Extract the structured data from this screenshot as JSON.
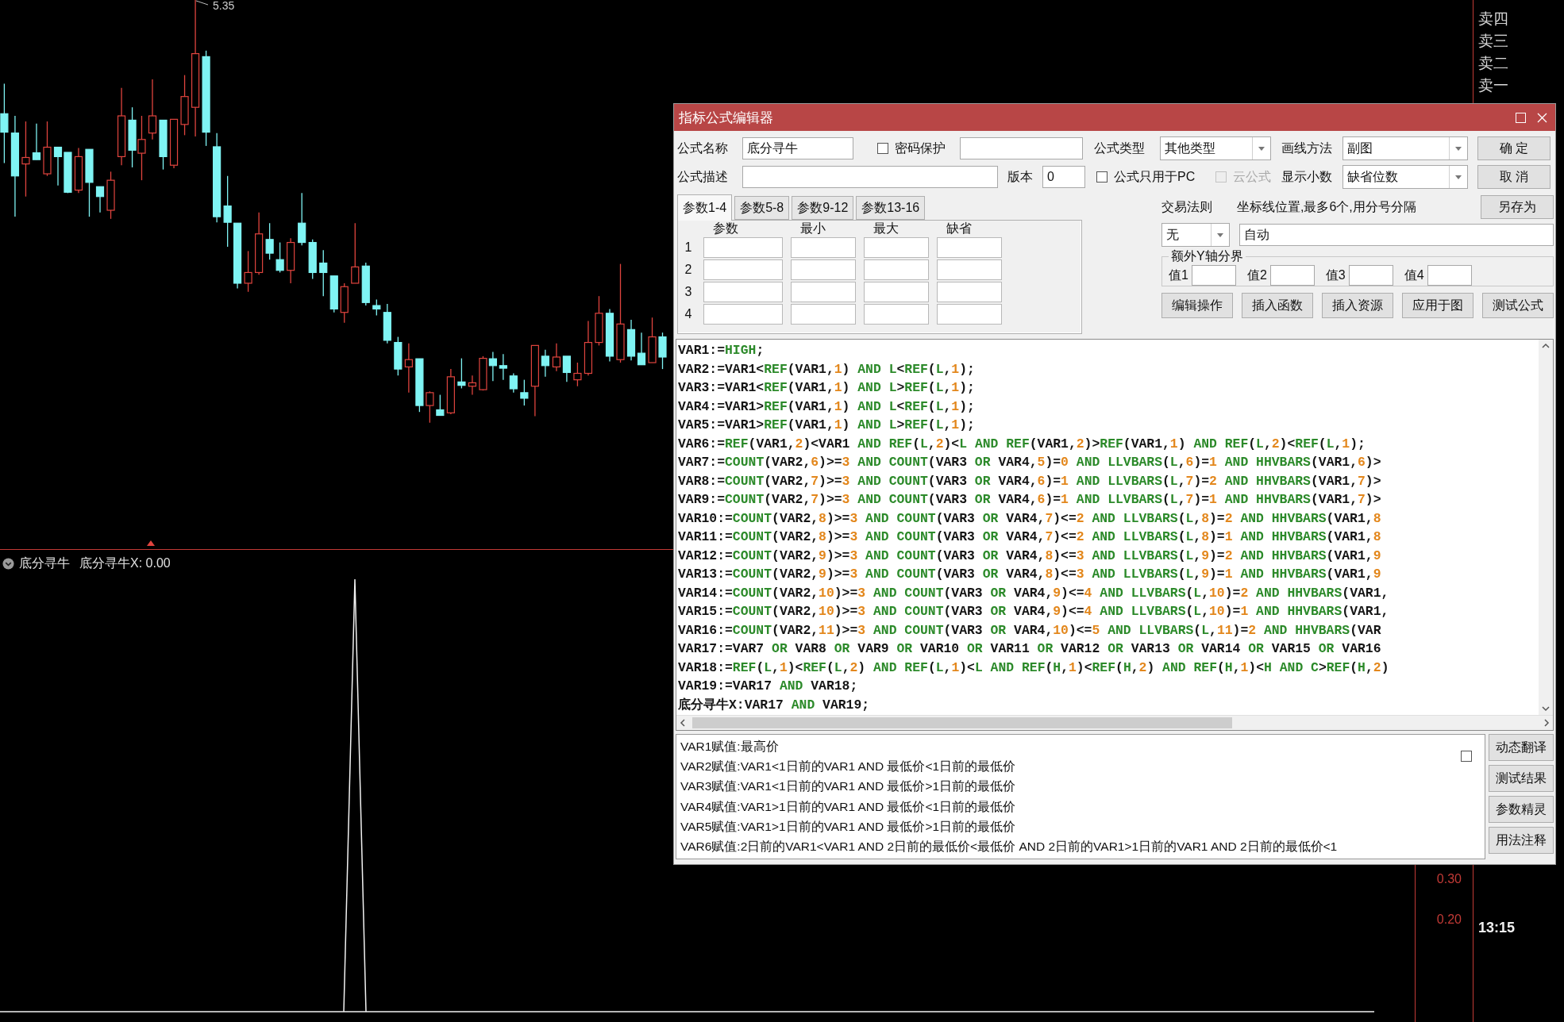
{
  "chart": {
    "high_label": "5.35"
  },
  "order_book": {
    "labels": [
      "卖四",
      "卖三",
      "卖二",
      "卖一"
    ]
  },
  "indicator_panel": {
    "name": "底分寻牛",
    "value_label": "底分寻牛X: 0.00",
    "axis_labels": [
      "0.30",
      "0.20"
    ],
    "time": "13:15"
  },
  "dialog": {
    "title": "指标公式编辑器",
    "name_label": "公式名称",
    "name_value": "底分寻牛",
    "password": {
      "label": "密码保护",
      "checked": false
    },
    "type_label": "公式类型",
    "type_value": "其他类型",
    "draw_label": "画线方法",
    "draw_value": "副图",
    "desc_label": "公式描述",
    "version_label": "版本",
    "version_value": "0",
    "pc_only": {
      "label": "公式只用于PC",
      "checked": false
    },
    "cloud": {
      "label": "云公式",
      "checked": false,
      "disabled": true
    },
    "decimals_label": "显示小数",
    "decimals_value": "缺省位数",
    "side_buttons": [
      "确 定",
      "取 消"
    ],
    "save_as_button": "另存为",
    "param_tabs": [
      {
        "label": "参数1-4",
        "selected": true
      },
      {
        "label": "参数5-8",
        "selected": false
      },
      {
        "label": "参数9-12",
        "selected": false
      },
      {
        "label": "参数13-16",
        "selected": false
      }
    ],
    "param_columns": [
      "参数",
      "最小",
      "最大",
      "缺省"
    ],
    "param_rows": [
      "1",
      "2",
      "3",
      "4"
    ],
    "trade_rule_label": "交易法则",
    "trade_rule_value": "无",
    "axis_label": "坐标线位置,最多6个,用分号分隔",
    "axis_value": "自动",
    "y_group": {
      "title": "额外Y轴分界",
      "values": [
        "值1",
        "值2",
        "值3",
        "值4"
      ]
    },
    "action_buttons": [
      "编辑操作",
      "插入函数",
      "插入资源",
      "应用于图",
      "测试公式"
    ],
    "code_lines": [
      {
        "tokens": [
          {
            "text": "VAR1:=",
            "kind": "plain"
          },
          {
            "text": "HIGH",
            "kind": "func"
          },
          {
            "text": ";",
            "kind": "plain"
          }
        ]
      },
      {
        "tokens": [
          {
            "text": "VAR2:=VAR1<",
            "kind": "plain"
          },
          {
            "text": "REF",
            "kind": "func"
          },
          {
            "text": "(VAR1,",
            "kind": "plain"
          },
          {
            "text": "1",
            "kind": "num"
          },
          {
            "text": ") ",
            "kind": "plain"
          },
          {
            "text": "AND L",
            "kind": "func"
          },
          {
            "text": "<",
            "kind": "plain"
          },
          {
            "text": "REF",
            "kind": "func"
          },
          {
            "text": "(",
            "kind": "plain"
          },
          {
            "text": "L",
            "kind": "func"
          },
          {
            "text": ",",
            "kind": "plain"
          },
          {
            "text": "1",
            "kind": "num"
          },
          {
            "text": ");",
            "kind": "plain"
          }
        ]
      },
      {
        "tokens": [
          {
            "text": "VAR3:=VAR1<",
            "kind": "plain"
          },
          {
            "text": "REF",
            "kind": "func"
          },
          {
            "text": "(VAR1,",
            "kind": "plain"
          },
          {
            "text": "1",
            "kind": "num"
          },
          {
            "text": ") ",
            "kind": "plain"
          },
          {
            "text": "AND L",
            "kind": "func"
          },
          {
            "text": ">",
            "kind": "plain"
          },
          {
            "text": "REF",
            "kind": "func"
          },
          {
            "text": "(",
            "kind": "plain"
          },
          {
            "text": "L",
            "kind": "func"
          },
          {
            "text": ",",
            "kind": "plain"
          },
          {
            "text": "1",
            "kind": "num"
          },
          {
            "text": ");",
            "kind": "plain"
          }
        ]
      },
      {
        "tokens": [
          {
            "text": "VAR4:=VAR1>",
            "kind": "plain"
          },
          {
            "text": "REF",
            "kind": "func"
          },
          {
            "text": "(VAR1,",
            "kind": "plain"
          },
          {
            "text": "1",
            "kind": "num"
          },
          {
            "text": ") ",
            "kind": "plain"
          },
          {
            "text": "AND L",
            "kind": "func"
          },
          {
            "text": "<",
            "kind": "plain"
          },
          {
            "text": "REF",
            "kind": "func"
          },
          {
            "text": "(",
            "kind": "plain"
          },
          {
            "text": "L",
            "kind": "func"
          },
          {
            "text": ",",
            "kind": "plain"
          },
          {
            "text": "1",
            "kind": "num"
          },
          {
            "text": ");",
            "kind": "plain"
          }
        ]
      },
      {
        "tokens": [
          {
            "text": "VAR5:=VAR1>",
            "kind": "plain"
          },
          {
            "text": "REF",
            "kind": "func"
          },
          {
            "text": "(VAR1,",
            "kind": "plain"
          },
          {
            "text": "1",
            "kind": "num"
          },
          {
            "text": ") ",
            "kind": "plain"
          },
          {
            "text": "AND L",
            "kind": "func"
          },
          {
            "text": ">",
            "kind": "plain"
          },
          {
            "text": "REF",
            "kind": "func"
          },
          {
            "text": "(",
            "kind": "plain"
          },
          {
            "text": "L",
            "kind": "func"
          },
          {
            "text": ",",
            "kind": "plain"
          },
          {
            "text": "1",
            "kind": "num"
          },
          {
            "text": ");",
            "kind": "plain"
          }
        ]
      },
      {
        "tokens": [
          {
            "text": "VAR6:=",
            "kind": "plain"
          },
          {
            "text": "REF",
            "kind": "func"
          },
          {
            "text": "(VAR1,",
            "kind": "plain"
          },
          {
            "text": "2",
            "kind": "num"
          },
          {
            "text": ")<VAR1 ",
            "kind": "plain"
          },
          {
            "text": "AND REF",
            "kind": "func"
          },
          {
            "text": "(",
            "kind": "plain"
          },
          {
            "text": "L",
            "kind": "func"
          },
          {
            "text": ",",
            "kind": "plain"
          },
          {
            "text": "2",
            "kind": "num"
          },
          {
            "text": ")<",
            "kind": "plain"
          },
          {
            "text": "L AND REF",
            "kind": "func"
          },
          {
            "text": "(VAR1,",
            "kind": "plain"
          },
          {
            "text": "2",
            "kind": "num"
          },
          {
            "text": ")>",
            "kind": "plain"
          },
          {
            "text": "REF",
            "kind": "func"
          },
          {
            "text": "(VAR1,",
            "kind": "plain"
          },
          {
            "text": "1",
            "kind": "num"
          },
          {
            "text": ") ",
            "kind": "plain"
          },
          {
            "text": "AND REF",
            "kind": "func"
          },
          {
            "text": "(",
            "kind": "plain"
          },
          {
            "text": "L",
            "kind": "func"
          },
          {
            "text": ",",
            "kind": "plain"
          },
          {
            "text": "2",
            "kind": "num"
          },
          {
            "text": ")<",
            "kind": "plain"
          },
          {
            "text": "REF",
            "kind": "func"
          },
          {
            "text": "(",
            "kind": "plain"
          },
          {
            "text": "L",
            "kind": "func"
          },
          {
            "text": ",",
            "kind": "plain"
          },
          {
            "text": "1",
            "kind": "num"
          },
          {
            "text": ");",
            "kind": "plain"
          }
        ]
      },
      {
        "tokens": [
          {
            "text": "VAR7:=",
            "kind": "plain"
          },
          {
            "text": "COUNT",
            "kind": "func"
          },
          {
            "text": "(VAR2,",
            "kind": "plain"
          },
          {
            "text": "6",
            "kind": "num"
          },
          {
            "text": ")>=",
            "kind": "plain"
          },
          {
            "text": "3",
            "kind": "num"
          },
          {
            "text": " AND COUNT",
            "kind": "func"
          },
          {
            "text": "(VAR3 ",
            "kind": "plain"
          },
          {
            "text": "OR",
            "kind": "func"
          },
          {
            "text": " VAR4,",
            "kind": "plain"
          },
          {
            "text": "5",
            "kind": "num"
          },
          {
            "text": ")=",
            "kind": "plain"
          },
          {
            "text": "0",
            "kind": "num"
          },
          {
            "text": " AND LLVBARS",
            "kind": "func"
          },
          {
            "text": "(",
            "kind": "plain"
          },
          {
            "text": "L",
            "kind": "func"
          },
          {
            "text": ",",
            "kind": "plain"
          },
          {
            "text": "6",
            "kind": "num"
          },
          {
            "text": ")=",
            "kind": "plain"
          },
          {
            "text": "1",
            "kind": "num"
          },
          {
            "text": " AND HHVBARS",
            "kind": "func"
          },
          {
            "text": "(VAR1,",
            "kind": "plain"
          },
          {
            "text": "6",
            "kind": "num"
          },
          {
            "text": ")>",
            "kind": "plain"
          }
        ]
      },
      {
        "tokens": [
          {
            "text": "VAR8:=",
            "kind": "plain"
          },
          {
            "text": "COUNT",
            "kind": "func"
          },
          {
            "text": "(VAR2,",
            "kind": "plain"
          },
          {
            "text": "7",
            "kind": "num"
          },
          {
            "text": ")>=",
            "kind": "plain"
          },
          {
            "text": "3",
            "kind": "num"
          },
          {
            "text": " AND COUNT",
            "kind": "func"
          },
          {
            "text": "(VAR3 ",
            "kind": "plain"
          },
          {
            "text": "OR",
            "kind": "func"
          },
          {
            "text": " VAR4,",
            "kind": "plain"
          },
          {
            "text": "6",
            "kind": "num"
          },
          {
            "text": ")=",
            "kind": "plain"
          },
          {
            "text": "1",
            "kind": "num"
          },
          {
            "text": " AND LLVBARS",
            "kind": "func"
          },
          {
            "text": "(",
            "kind": "plain"
          },
          {
            "text": "L",
            "kind": "func"
          },
          {
            "text": ",",
            "kind": "plain"
          },
          {
            "text": "7",
            "kind": "num"
          },
          {
            "text": ")=",
            "kind": "plain"
          },
          {
            "text": "2",
            "kind": "num"
          },
          {
            "text": " AND HHVBARS",
            "kind": "func"
          },
          {
            "text": "(VAR1,",
            "kind": "plain"
          },
          {
            "text": "7",
            "kind": "num"
          },
          {
            "text": ")>",
            "kind": "plain"
          }
        ]
      },
      {
        "tokens": [
          {
            "text": "VAR9:=",
            "kind": "plain"
          },
          {
            "text": "COUNT",
            "kind": "func"
          },
          {
            "text": "(VAR2,",
            "kind": "plain"
          },
          {
            "text": "7",
            "kind": "num"
          },
          {
            "text": ")>=",
            "kind": "plain"
          },
          {
            "text": "3",
            "kind": "num"
          },
          {
            "text": " AND COUNT",
            "kind": "func"
          },
          {
            "text": "(VAR3 ",
            "kind": "plain"
          },
          {
            "text": "OR",
            "kind": "func"
          },
          {
            "text": " VAR4,",
            "kind": "plain"
          },
          {
            "text": "6",
            "kind": "num"
          },
          {
            "text": ")=",
            "kind": "plain"
          },
          {
            "text": "1",
            "kind": "num"
          },
          {
            "text": " AND LLVBARS",
            "kind": "func"
          },
          {
            "text": "(",
            "kind": "plain"
          },
          {
            "text": "L",
            "kind": "func"
          },
          {
            "text": ",",
            "kind": "plain"
          },
          {
            "text": "7",
            "kind": "num"
          },
          {
            "text": ")=",
            "kind": "plain"
          },
          {
            "text": "1",
            "kind": "num"
          },
          {
            "text": " AND HHVBARS",
            "kind": "func"
          },
          {
            "text": "(VAR1,",
            "kind": "plain"
          },
          {
            "text": "7",
            "kind": "num"
          },
          {
            "text": ")>",
            "kind": "plain"
          }
        ]
      },
      {
        "tokens": [
          {
            "text": "VAR10:=",
            "kind": "plain"
          },
          {
            "text": "COUNT",
            "kind": "func"
          },
          {
            "text": "(VAR2,",
            "kind": "plain"
          },
          {
            "text": "8",
            "kind": "num"
          },
          {
            "text": ")>=",
            "kind": "plain"
          },
          {
            "text": "3",
            "kind": "num"
          },
          {
            "text": " AND COUNT",
            "kind": "func"
          },
          {
            "text": "(VAR3 ",
            "kind": "plain"
          },
          {
            "text": "OR",
            "kind": "func"
          },
          {
            "text": " VAR4,",
            "kind": "plain"
          },
          {
            "text": "7",
            "kind": "num"
          },
          {
            "text": ")<=",
            "kind": "plain"
          },
          {
            "text": "2",
            "kind": "num"
          },
          {
            "text": " AND LLVBARS",
            "kind": "func"
          },
          {
            "text": "(",
            "kind": "plain"
          },
          {
            "text": "L",
            "kind": "func"
          },
          {
            "text": ",",
            "kind": "plain"
          },
          {
            "text": "8",
            "kind": "num"
          },
          {
            "text": ")=",
            "kind": "plain"
          },
          {
            "text": "2",
            "kind": "num"
          },
          {
            "text": " AND HHVBARS",
            "kind": "func"
          },
          {
            "text": "(VAR1,",
            "kind": "plain"
          },
          {
            "text": "8",
            "kind": "num"
          }
        ]
      },
      {
        "tokens": [
          {
            "text": "VAR11:=",
            "kind": "plain"
          },
          {
            "text": "COUNT",
            "kind": "func"
          },
          {
            "text": "(VAR2,",
            "kind": "plain"
          },
          {
            "text": "8",
            "kind": "num"
          },
          {
            "text": ")>=",
            "kind": "plain"
          },
          {
            "text": "3",
            "kind": "num"
          },
          {
            "text": " AND COUNT",
            "kind": "func"
          },
          {
            "text": "(VAR3 ",
            "kind": "plain"
          },
          {
            "text": "OR",
            "kind": "func"
          },
          {
            "text": " VAR4,",
            "kind": "plain"
          },
          {
            "text": "7",
            "kind": "num"
          },
          {
            "text": ")<=",
            "kind": "plain"
          },
          {
            "text": "2",
            "kind": "num"
          },
          {
            "text": " AND LLVBARS",
            "kind": "func"
          },
          {
            "text": "(",
            "kind": "plain"
          },
          {
            "text": "L",
            "kind": "func"
          },
          {
            "text": ",",
            "kind": "plain"
          },
          {
            "text": "8",
            "kind": "num"
          },
          {
            "text": ")=",
            "kind": "plain"
          },
          {
            "text": "1",
            "kind": "num"
          },
          {
            "text": " AND HHVBARS",
            "kind": "func"
          },
          {
            "text": "(VAR1,",
            "kind": "plain"
          },
          {
            "text": "8",
            "kind": "num"
          }
        ]
      },
      {
        "tokens": [
          {
            "text": "VAR12:=",
            "kind": "plain"
          },
          {
            "text": "COUNT",
            "kind": "func"
          },
          {
            "text": "(VAR2,",
            "kind": "plain"
          },
          {
            "text": "9",
            "kind": "num"
          },
          {
            "text": ")>=",
            "kind": "plain"
          },
          {
            "text": "3",
            "kind": "num"
          },
          {
            "text": " AND COUNT",
            "kind": "func"
          },
          {
            "text": "(VAR3 ",
            "kind": "plain"
          },
          {
            "text": "OR",
            "kind": "func"
          },
          {
            "text": " VAR4,",
            "kind": "plain"
          },
          {
            "text": "8",
            "kind": "num"
          },
          {
            "text": ")<=",
            "kind": "plain"
          },
          {
            "text": "3",
            "kind": "num"
          },
          {
            "text": " AND LLVBARS",
            "kind": "func"
          },
          {
            "text": "(",
            "kind": "plain"
          },
          {
            "text": "L",
            "kind": "func"
          },
          {
            "text": ",",
            "kind": "plain"
          },
          {
            "text": "9",
            "kind": "num"
          },
          {
            "text": ")=",
            "kind": "plain"
          },
          {
            "text": "2",
            "kind": "num"
          },
          {
            "text": " AND HHVBARS",
            "kind": "func"
          },
          {
            "text": "(VAR1,",
            "kind": "plain"
          },
          {
            "text": "9",
            "kind": "num"
          }
        ]
      },
      {
        "tokens": [
          {
            "text": "VAR13:=",
            "kind": "plain"
          },
          {
            "text": "COUNT",
            "kind": "func"
          },
          {
            "text": "(VAR2,",
            "kind": "plain"
          },
          {
            "text": "9",
            "kind": "num"
          },
          {
            "text": ")>=",
            "kind": "plain"
          },
          {
            "text": "3",
            "kind": "num"
          },
          {
            "text": " AND COUNT",
            "kind": "func"
          },
          {
            "text": "(VAR3 ",
            "kind": "plain"
          },
          {
            "text": "OR",
            "kind": "func"
          },
          {
            "text": " VAR4,",
            "kind": "plain"
          },
          {
            "text": "8",
            "kind": "num"
          },
          {
            "text": ")<=",
            "kind": "plain"
          },
          {
            "text": "3",
            "kind": "num"
          },
          {
            "text": " AND LLVBARS",
            "kind": "func"
          },
          {
            "text": "(",
            "kind": "plain"
          },
          {
            "text": "L",
            "kind": "func"
          },
          {
            "text": ",",
            "kind": "plain"
          },
          {
            "text": "9",
            "kind": "num"
          },
          {
            "text": ")=",
            "kind": "plain"
          },
          {
            "text": "1",
            "kind": "num"
          },
          {
            "text": " AND HHVBARS",
            "kind": "func"
          },
          {
            "text": "(VAR1,",
            "kind": "plain"
          },
          {
            "text": "9",
            "kind": "num"
          }
        ]
      },
      {
        "tokens": [
          {
            "text": "VAR14:=",
            "kind": "plain"
          },
          {
            "text": "COUNT",
            "kind": "func"
          },
          {
            "text": "(VAR2,",
            "kind": "plain"
          },
          {
            "text": "10",
            "kind": "num"
          },
          {
            "text": ")>=",
            "kind": "plain"
          },
          {
            "text": "3",
            "kind": "num"
          },
          {
            "text": " AND COUNT",
            "kind": "func"
          },
          {
            "text": "(VAR3 ",
            "kind": "plain"
          },
          {
            "text": "OR",
            "kind": "func"
          },
          {
            "text": " VAR4,",
            "kind": "plain"
          },
          {
            "text": "9",
            "kind": "num"
          },
          {
            "text": ")<=",
            "kind": "plain"
          },
          {
            "text": "4",
            "kind": "num"
          },
          {
            "text": " AND LLVBARS",
            "kind": "func"
          },
          {
            "text": "(",
            "kind": "plain"
          },
          {
            "text": "L",
            "kind": "func"
          },
          {
            "text": ",",
            "kind": "plain"
          },
          {
            "text": "10",
            "kind": "num"
          },
          {
            "text": ")=",
            "kind": "plain"
          },
          {
            "text": "2",
            "kind": "num"
          },
          {
            "text": " AND HHVBARS",
            "kind": "func"
          },
          {
            "text": "(VAR1,",
            "kind": "plain"
          }
        ]
      },
      {
        "tokens": [
          {
            "text": "VAR15:=",
            "kind": "plain"
          },
          {
            "text": "COUNT",
            "kind": "func"
          },
          {
            "text": "(VAR2,",
            "kind": "plain"
          },
          {
            "text": "10",
            "kind": "num"
          },
          {
            "text": ")>=",
            "kind": "plain"
          },
          {
            "text": "3",
            "kind": "num"
          },
          {
            "text": " AND COUNT",
            "kind": "func"
          },
          {
            "text": "(VAR3 ",
            "kind": "plain"
          },
          {
            "text": "OR",
            "kind": "func"
          },
          {
            "text": " VAR4,",
            "kind": "plain"
          },
          {
            "text": "9",
            "kind": "num"
          },
          {
            "text": ")<=",
            "kind": "plain"
          },
          {
            "text": "4",
            "kind": "num"
          },
          {
            "text": " AND LLVBARS",
            "kind": "func"
          },
          {
            "text": "(",
            "kind": "plain"
          },
          {
            "text": "L",
            "kind": "func"
          },
          {
            "text": ",",
            "kind": "plain"
          },
          {
            "text": "10",
            "kind": "num"
          },
          {
            "text": ")=",
            "kind": "plain"
          },
          {
            "text": "1",
            "kind": "num"
          },
          {
            "text": " AND HHVBARS",
            "kind": "func"
          },
          {
            "text": "(VAR1,",
            "kind": "plain"
          }
        ]
      },
      {
        "tokens": [
          {
            "text": "VAR16:=",
            "kind": "plain"
          },
          {
            "text": "COUNT",
            "kind": "func"
          },
          {
            "text": "(VAR2,",
            "kind": "plain"
          },
          {
            "text": "11",
            "kind": "num"
          },
          {
            "text": ")>=",
            "kind": "plain"
          },
          {
            "text": "3",
            "kind": "num"
          },
          {
            "text": " AND COUNT",
            "kind": "func"
          },
          {
            "text": "(VAR3 ",
            "kind": "plain"
          },
          {
            "text": "OR",
            "kind": "func"
          },
          {
            "text": " VAR4,",
            "kind": "plain"
          },
          {
            "text": "10",
            "kind": "num"
          },
          {
            "text": ")<=",
            "kind": "plain"
          },
          {
            "text": "5",
            "kind": "num"
          },
          {
            "text": " AND LLVBARS",
            "kind": "func"
          },
          {
            "text": "(",
            "kind": "plain"
          },
          {
            "text": "L",
            "kind": "func"
          },
          {
            "text": ",",
            "kind": "plain"
          },
          {
            "text": "11",
            "kind": "num"
          },
          {
            "text": ")=",
            "kind": "plain"
          },
          {
            "text": "2",
            "kind": "num"
          },
          {
            "text": " AND HHVBARS",
            "kind": "func"
          },
          {
            "text": "(VAR",
            "kind": "plain"
          }
        ]
      },
      {
        "tokens": [
          {
            "text": "VAR17:=VAR7 ",
            "kind": "plain"
          },
          {
            "text": "OR",
            "kind": "func"
          },
          {
            "text": " VAR8 ",
            "kind": "plain"
          },
          {
            "text": "OR",
            "kind": "func"
          },
          {
            "text": " VAR9 ",
            "kind": "plain"
          },
          {
            "text": "OR",
            "kind": "func"
          },
          {
            "text": " VAR10 ",
            "kind": "plain"
          },
          {
            "text": "OR",
            "kind": "func"
          },
          {
            "text": " VAR11 ",
            "kind": "plain"
          },
          {
            "text": "OR",
            "kind": "func"
          },
          {
            "text": " VAR12 ",
            "kind": "plain"
          },
          {
            "text": "OR",
            "kind": "func"
          },
          {
            "text": " VAR13 ",
            "kind": "plain"
          },
          {
            "text": "OR",
            "kind": "func"
          },
          {
            "text": " VAR14 ",
            "kind": "plain"
          },
          {
            "text": "OR",
            "kind": "func"
          },
          {
            "text": " VAR15 ",
            "kind": "plain"
          },
          {
            "text": "OR",
            "kind": "func"
          },
          {
            "text": " VAR16",
            "kind": "plain"
          }
        ]
      },
      {
        "tokens": [
          {
            "text": "VAR18:=",
            "kind": "plain"
          },
          {
            "text": "REF",
            "kind": "func"
          },
          {
            "text": "(",
            "kind": "plain"
          },
          {
            "text": "L",
            "kind": "func"
          },
          {
            "text": ",",
            "kind": "plain"
          },
          {
            "text": "1",
            "kind": "num"
          },
          {
            "text": ")<",
            "kind": "plain"
          },
          {
            "text": "REF",
            "kind": "func"
          },
          {
            "text": "(",
            "kind": "plain"
          },
          {
            "text": "L",
            "kind": "func"
          },
          {
            "text": ",",
            "kind": "plain"
          },
          {
            "text": "2",
            "kind": "num"
          },
          {
            "text": ") ",
            "kind": "plain"
          },
          {
            "text": "AND REF",
            "kind": "func"
          },
          {
            "text": "(",
            "kind": "plain"
          },
          {
            "text": "L",
            "kind": "func"
          },
          {
            "text": ",",
            "kind": "plain"
          },
          {
            "text": "1",
            "kind": "num"
          },
          {
            "text": ")<",
            "kind": "plain"
          },
          {
            "text": "L AND REF",
            "kind": "func"
          },
          {
            "text": "(",
            "kind": "plain"
          },
          {
            "text": "H",
            "kind": "func"
          },
          {
            "text": ",",
            "kind": "plain"
          },
          {
            "text": "1",
            "kind": "num"
          },
          {
            "text": ")<",
            "kind": "plain"
          },
          {
            "text": "REF",
            "kind": "func"
          },
          {
            "text": "(",
            "kind": "plain"
          },
          {
            "text": "H",
            "kind": "func"
          },
          {
            "text": ",",
            "kind": "plain"
          },
          {
            "text": "2",
            "kind": "num"
          },
          {
            "text": ") ",
            "kind": "plain"
          },
          {
            "text": "AND REF",
            "kind": "func"
          },
          {
            "text": "(",
            "kind": "plain"
          },
          {
            "text": "H",
            "kind": "func"
          },
          {
            "text": ",",
            "kind": "plain"
          },
          {
            "text": "1",
            "kind": "num"
          },
          {
            "text": ")<",
            "kind": "plain"
          },
          {
            "text": "H AND C",
            "kind": "func"
          },
          {
            "text": ">",
            "kind": "plain"
          },
          {
            "text": "REF",
            "kind": "func"
          },
          {
            "text": "(",
            "kind": "plain"
          },
          {
            "text": "H",
            "kind": "func"
          },
          {
            "text": ",",
            "kind": "plain"
          },
          {
            "text": "2",
            "kind": "num"
          },
          {
            "text": ")",
            "kind": "plain"
          }
        ]
      },
      {
        "tokens": [
          {
            "text": "VAR19:=VAR17 ",
            "kind": "plain"
          },
          {
            "text": "AND",
            "kind": "func"
          },
          {
            "text": " VAR18;",
            "kind": "plain"
          }
        ]
      },
      {
        "tokens": [
          {
            "text": "底分寻牛X:VAR17 ",
            "kind": "plain"
          },
          {
            "text": "AND",
            "kind": "func"
          },
          {
            "text": " VAR19;",
            "kind": "plain"
          }
        ]
      }
    ],
    "explanation_lines": [
      "VAR1赋值:最高价",
      "VAR2赋值:VAR1<1日前的VAR1 AND 最低价<1日前的最低价",
      "VAR3赋值:VAR1<1日前的VAR1 AND 最低价>1日前的最低价",
      "VAR4赋值:VAR1>1日前的VAR1 AND 最低价<1日前的最低价",
      "VAR5赋值:VAR1>1日前的VAR1 AND 最低价>1日前的最低价",
      "VAR6赋值:2日前的VAR1<VAR1 AND 2日前的最低价<最低价 AND 2日前的VAR1>1日前的VAR1 AND 2日前的最低价<1"
    ],
    "explanation_checkbox": {
      "checked": false
    },
    "explanation_buttons": [
      "动态翻译",
      "测试结果",
      "参数精灵",
      "用法注释"
    ]
  }
}
